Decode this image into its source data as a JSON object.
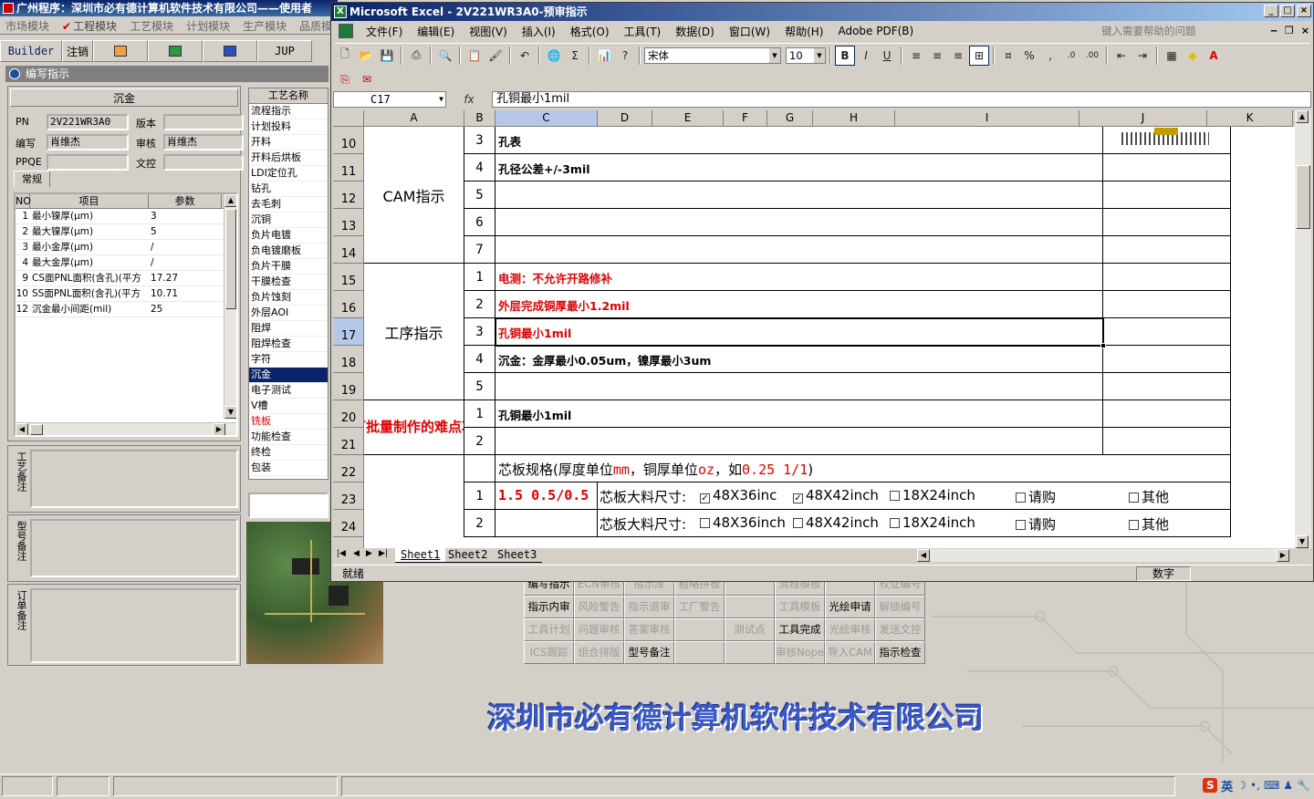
{
  "bg_app": {
    "title": "广州程序：深圳市必有德计算机软件技术有限公司——使用者",
    "modules": [
      "市场模块",
      "工程模块",
      "工艺模块",
      "计划模块",
      "生产模块",
      "品质模"
    ],
    "active_module": "工程模块",
    "toolbar": {
      "builder": "Builder",
      "logout": "注销",
      "jup": "JUP"
    },
    "window_title": "编写指示",
    "section_title": "沉金",
    "form": {
      "pn_label": "PN",
      "pn_value": "2V221WR3A0",
      "version_label": "版本",
      "version_value": "",
      "author_label": "编写",
      "author_value": "肖维杰",
      "review_label": "审核",
      "review_value": "肖维杰",
      "ppqe_label": "PPQE",
      "ppqe_value": "",
      "doc_label": "文控",
      "doc_value": ""
    },
    "tab_label": "常规",
    "param_headers": [
      "NO",
      "项目",
      "参数"
    ],
    "params": [
      {
        "no": "1",
        "item": "最小镍厚(μm)",
        "value": "3"
      },
      {
        "no": "2",
        "item": "最大镍厚(μm)",
        "value": "5"
      },
      {
        "no": "3",
        "item": "最小金厚(μm)",
        "value": "/"
      },
      {
        "no": "4",
        "item": "最大金厚(μm)",
        "value": "/"
      },
      {
        "no": "9",
        "item": "CS面PNL面积(含孔)(平方",
        "value": "17.27"
      },
      {
        "no": "10",
        "item": "SS面PNL面积(含孔)(平方",
        "value": "10.71"
      },
      {
        "no": "12",
        "item": "沉金最小间距(mil)",
        "value": "25"
      }
    ],
    "notes": [
      {
        "label": "工艺备注"
      },
      {
        "label": "型号备注"
      },
      {
        "label": "订单备注"
      }
    ],
    "process_header": "工艺名称",
    "processes": [
      {
        "name": "流程指示",
        "state": "normal"
      },
      {
        "name": "计划投料",
        "state": "normal"
      },
      {
        "name": "开料",
        "state": "normal"
      },
      {
        "name": "开料后烘板",
        "state": "normal"
      },
      {
        "name": "LDI定位孔",
        "state": "normal"
      },
      {
        "name": "钻孔",
        "state": "normal"
      },
      {
        "name": "去毛刺",
        "state": "normal"
      },
      {
        "name": "沉铜",
        "state": "normal"
      },
      {
        "name": "负片电镀",
        "state": "normal"
      },
      {
        "name": "负电镀磨板",
        "state": "normal"
      },
      {
        "name": "负片干膜",
        "state": "normal"
      },
      {
        "name": "干膜检查",
        "state": "normal"
      },
      {
        "name": "负片蚀刻",
        "state": "normal"
      },
      {
        "name": "外层AOI",
        "state": "normal"
      },
      {
        "name": "阻焊",
        "state": "normal"
      },
      {
        "name": "阻焊检查",
        "state": "normal"
      },
      {
        "name": "字符",
        "state": "normal"
      },
      {
        "name": "沉金",
        "state": "selected"
      },
      {
        "name": "电子测试",
        "state": "normal"
      },
      {
        "name": "V槽",
        "state": "normal"
      },
      {
        "name": "铣板",
        "state": "red"
      },
      {
        "name": "功能检查",
        "state": "normal"
      },
      {
        "name": "终检",
        "state": "normal"
      },
      {
        "name": "包装",
        "state": "normal"
      }
    ],
    "button_grid": [
      {
        "label": "编写指示",
        "dim": false
      },
      {
        "label": "ECN审核",
        "dim": true
      },
      {
        "label": "指示库",
        "dim": true
      },
      {
        "label": "粗略拼板",
        "dim": true
      },
      {
        "label": "",
        "dim": true
      },
      {
        "label": "流程模板",
        "dim": true
      },
      {
        "label": "",
        "dim": true
      },
      {
        "label": "权证编号",
        "dim": true
      },
      {
        "label": "指示内审",
        "dim": false
      },
      {
        "label": "风险警告",
        "dim": true
      },
      {
        "label": "指示退审",
        "dim": true
      },
      {
        "label": "工厂警告",
        "dim": true
      },
      {
        "label": "",
        "dim": true
      },
      {
        "label": "工具模板",
        "dim": true
      },
      {
        "label": "光绘申请",
        "dim": false
      },
      {
        "label": "解锁编号",
        "dim": true
      },
      {
        "label": "工具计划",
        "dim": true
      },
      {
        "label": "问题审核",
        "dim": true
      },
      {
        "label": "答案审核",
        "dim": true
      },
      {
        "label": "",
        "dim": true
      },
      {
        "label": "测试点",
        "dim": true
      },
      {
        "label": "工具完成",
        "dim": false
      },
      {
        "label": "光绘审核",
        "dim": true
      },
      {
        "label": "发送文控",
        "dim": true
      },
      {
        "label": "ICS跟踪",
        "dim": true
      },
      {
        "label": "组合排版",
        "dim": true
      },
      {
        "label": "型号备注",
        "dim": false
      },
      {
        "label": "",
        "dim": true
      },
      {
        "label": "",
        "dim": true
      },
      {
        "label": "审核Nope",
        "dim": true
      },
      {
        "label": "导入CAM",
        "dim": true
      },
      {
        "label": "指示检查",
        "dim": false
      }
    ],
    "company_banner": "深圳市必有德计算机软件技术有限公司",
    "ime": {
      "logo": "S",
      "lang": "英"
    }
  },
  "excel": {
    "title": "Microsoft Excel - 2V221WR3A0-预审指示",
    "menu": [
      "文件(F)",
      "编辑(E)",
      "视图(V)",
      "插入(I)",
      "格式(O)",
      "工具(T)",
      "数据(D)",
      "窗口(W)",
      "帮助(H)",
      "Adobe PDF(B)"
    ],
    "help_placeholder": "键入需要帮助的问题",
    "font_name": "宋体",
    "font_size": "10",
    "name_box": "C17",
    "formula": "孔铜最小1mil",
    "columns": [
      "A",
      "B",
      "C",
      "D",
      "E",
      "F",
      "G",
      "H",
      "I",
      "J",
      "K"
    ],
    "rows": [
      {
        "row": "10",
        "b": "3",
        "c": "孔表",
        "red": false
      },
      {
        "row": "11",
        "b": "4",
        "c": "孔径公差+/-3mil",
        "red": false
      },
      {
        "row": "12",
        "b": "5",
        "c": "",
        "red": false
      },
      {
        "row": "13",
        "b": "6",
        "c": "",
        "red": false
      },
      {
        "row": "14",
        "b": "7",
        "c": "",
        "red": false
      },
      {
        "row": "15",
        "b": "1",
        "c": "电测：不允许开路修补",
        "red": true
      },
      {
        "row": "16",
        "b": "2",
        "c": "外层完成铜厚最小1.2mil",
        "red": true
      },
      {
        "row": "17",
        "b": "3",
        "c": "孔铜最小1mil",
        "red": true
      },
      {
        "row": "18",
        "b": "4",
        "c": "沉金：金厚最小0.05um，镍厚最小3um",
        "red": false
      },
      {
        "row": "19",
        "b": "5",
        "c": "",
        "red": false
      },
      {
        "row": "20",
        "b": "1",
        "c": "孔铜最小1mil",
        "red": false
      },
      {
        "row": "21",
        "b": "2",
        "c": "",
        "red": false
      }
    ],
    "area_cam": "CAM指示",
    "area_process": "工序指示",
    "area_difficult": "不可批量制作的难点项目",
    "row22": {
      "row": "22",
      "text_a": "芯板规格(厚度单位",
      "text_b": "mm",
      "text_c": "，铜厚单位",
      "text_d": "oz",
      "text_e": "，如",
      "text_f": "0.25 1/1",
      "text_g": ")"
    },
    "row23": {
      "row": "23",
      "b": "1",
      "c": "1.5 0.5/0.5",
      "label": "芯板大料尺寸:",
      "options": [
        {
          "text": "48X36inc",
          "checked": true
        },
        {
          "text": "48X42inch",
          "checked": true
        },
        {
          "text": "18X24inch",
          "checked": false
        },
        {
          "text": "请购",
          "checked": false
        },
        {
          "text": "其他",
          "checked": false
        }
      ]
    },
    "row24": {
      "row": "24",
      "b": "2",
      "c": "",
      "label": "芯板大料尺寸:",
      "options": [
        {
          "text": "48X36inch",
          "checked": false
        },
        {
          "text": "48X42inch",
          "checked": false
        },
        {
          "text": "18X24inch",
          "checked": false
        },
        {
          "text": "请购",
          "checked": false
        },
        {
          "text": "其他",
          "checked": false
        }
      ]
    },
    "sheets": [
      "Sheet1",
      "Sheet2",
      "Sheet3"
    ],
    "active_sheet": "Sheet1",
    "status": "就绪",
    "num_indicator": "数字",
    "colors": {
      "red": "#e00000",
      "title_blue": "#0a246a",
      "selection": "#b6c8e8"
    }
  }
}
